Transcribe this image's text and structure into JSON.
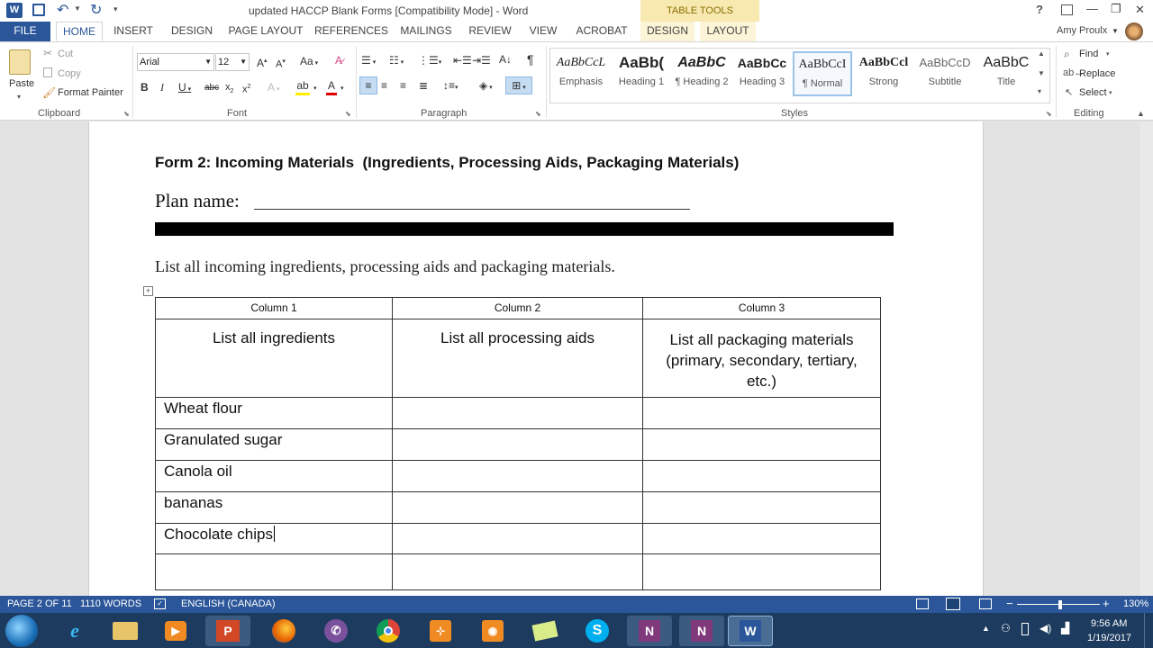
{
  "titlebar": {
    "doc_title": "updated HACCP Blank Forms [Compatibility Mode] - Word",
    "contextual_group": "TABLE TOOLS",
    "help": "?",
    "min": "—",
    "restore": "❐",
    "close": "✕"
  },
  "tabs": [
    "FILE",
    "HOME",
    "INSERT",
    "DESIGN",
    "PAGE LAYOUT",
    "REFERENCES",
    "MAILINGS",
    "REVIEW",
    "VIEW",
    "ACROBAT",
    "DESIGN",
    "LAYOUT"
  ],
  "user": "Amy Proulx",
  "clipboard": {
    "paste": "Paste",
    "cut": "Cut",
    "copy": "Copy",
    "format_painter": "Format Painter",
    "label": "Clipboard"
  },
  "font": {
    "family": "Arial",
    "size": "12",
    "label": "Font"
  },
  "paragraph": {
    "label": "Paragraph"
  },
  "styles": {
    "label": "Styles",
    "items": [
      {
        "preview": "AaBbCcL",
        "name": "Emphasis"
      },
      {
        "preview": "AaBb(",
        "name": "Heading 1"
      },
      {
        "preview": "AaBbC",
        "name": "¶ Heading 2"
      },
      {
        "preview": "AaBbCc",
        "name": "Heading 3"
      },
      {
        "preview": "AaBbCcI",
        "name": "¶ Normal"
      },
      {
        "preview": "AaBbCcl",
        "name": "Strong"
      },
      {
        "preview": "AaBbCcD",
        "name": "Subtitle"
      },
      {
        "preview": "AaBbC",
        "name": "Title"
      }
    ]
  },
  "editing": {
    "find": "Find",
    "replace": "Replace",
    "select": "Select",
    "label": "Editing"
  },
  "document": {
    "heading": "Form 2: Incoming Materials  (Ingredients, Processing Aids, Packaging Materials)",
    "plan_name_label": "Plan name:",
    "instruction": "List all incoming ingredients, processing aids and packaging materials.",
    "table": {
      "columns": [
        "Column 1",
        "Column 2",
        "Column 3"
      ],
      "headers": [
        "List all ingredients",
        "List all processing aids",
        "List all packaging materials (primary, secondary, tertiary, etc.)"
      ],
      "rows": [
        [
          "Wheat flour",
          "",
          ""
        ],
        [
          "Granulated sugar",
          "",
          ""
        ],
        [
          "Canola oil",
          "",
          ""
        ],
        [
          "bananas",
          "",
          ""
        ],
        [
          "Chocolate chips",
          "",
          ""
        ],
        [
          "",
          "",
          ""
        ]
      ]
    }
  },
  "status": {
    "page": "PAGE 2 OF 11",
    "words": "1110 WORDS",
    "language": "ENGLISH (CANADA)",
    "zoom": "130%"
  },
  "taskbar": {
    "time": "9:56 AM",
    "date": "1/19/2017",
    "icons": [
      "start-orb",
      "internet-explorer",
      "file-explorer",
      "media-player",
      "powerpoint",
      "firefox",
      "viber",
      "chrome",
      "snipping-tool",
      "camera-app",
      "sticky-notes",
      "skype",
      "onenote",
      "onenote-2",
      "word"
    ]
  },
  "colors": {
    "word_blue": "#2b579a",
    "contextual_yellow": "#f7e9b0",
    "taskbar": "#1c3b5e"
  }
}
